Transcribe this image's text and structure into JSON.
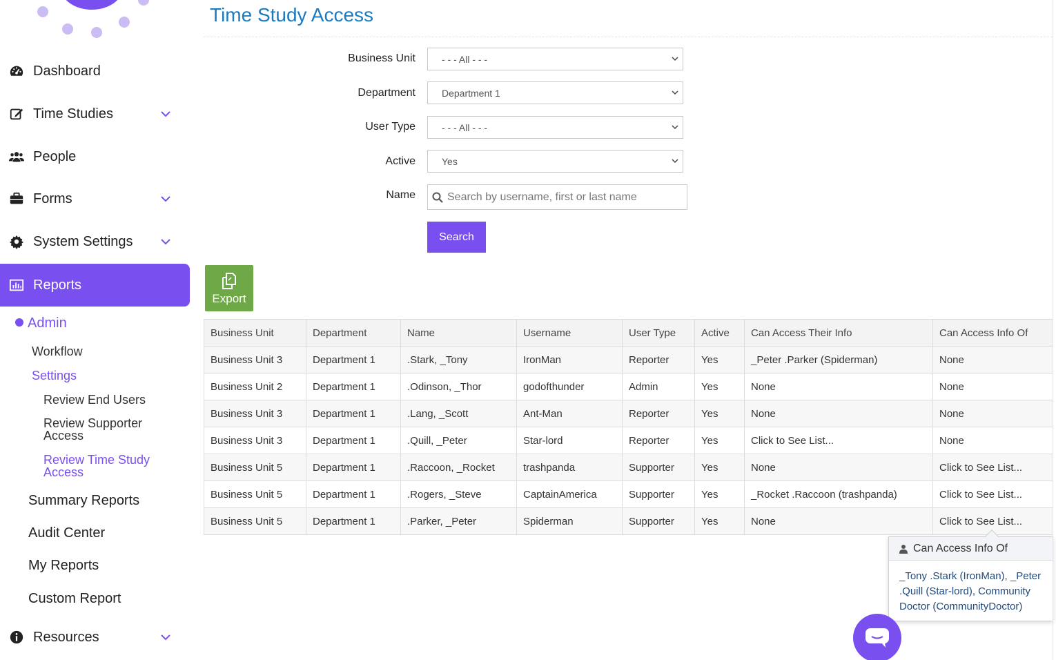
{
  "page_title": "Time Study Access",
  "sidebar": {
    "nav": [
      {
        "label": "Dashboard",
        "icon": "dashboard-icon",
        "has_chevron": false
      },
      {
        "label": "Time Studies",
        "icon": "edit-icon",
        "has_chevron": true
      },
      {
        "label": "People",
        "icon": "users-icon",
        "has_chevron": false
      },
      {
        "label": "Forms",
        "icon": "briefcase-icon",
        "has_chevron": true
      },
      {
        "label": "System Settings",
        "icon": "gear-icon",
        "has_chevron": true
      },
      {
        "label": "Reports",
        "icon": "bar-chart-icon",
        "has_chevron": false,
        "active": true
      }
    ],
    "reports_sub": {
      "admin": "Admin",
      "workflow": "Workflow",
      "settings": "Settings",
      "review_end_users": "Review End Users",
      "review_supporter_access_1": "Review Supporter",
      "review_supporter_access_2": "Access",
      "review_time_study_access_1": "Review Time Study",
      "review_time_study_access_2": "Access",
      "summary_reports": "Summary Reports",
      "audit_center": "Audit Center",
      "my_reports": "My Reports",
      "custom_report": "Custom Report"
    },
    "resources": {
      "label": "Resources",
      "icon": "info-icon"
    }
  },
  "filters": {
    "business_unit": {
      "label": "Business Unit",
      "value": "- - - All - - -"
    },
    "department": {
      "label": "Department",
      "value": "Department 1"
    },
    "user_type": {
      "label": "User Type",
      "value": "- - - All - - -"
    },
    "active": {
      "label": "Active",
      "value": "Yes"
    },
    "name": {
      "label": "Name",
      "placeholder": "Search by username, first or last name"
    },
    "search_button": "Search"
  },
  "export_label": "Export",
  "table": {
    "headers": [
      "Business Unit",
      "Department",
      "Name",
      "Username",
      "User Type",
      "Active",
      "Can Access Their Info",
      "Can Access Info Of"
    ],
    "rows": [
      [
        "Business Unit 3",
        "Department 1",
        ".Stark, _Tony",
        "IronMan",
        "Reporter",
        "Yes",
        "_Peter .Parker (Spiderman)",
        "None"
      ],
      [
        "Business Unit 2",
        "Department 1",
        ".Odinson, _Thor",
        "godofthunder",
        "Admin",
        "Yes",
        "None",
        "None"
      ],
      [
        "Business Unit 3",
        "Department 1",
        ".Lang, _Scott",
        "Ant-Man",
        "Reporter",
        "Yes",
        "None",
        "None"
      ],
      [
        "Business Unit 3",
        "Department 1",
        ".Quill, _Peter",
        "Star-lord",
        "Reporter",
        "Yes",
        "Click to See List...",
        "None"
      ],
      [
        "Business Unit 5",
        "Department 1",
        ".Raccoon, _Rocket",
        "trashpanda",
        "Supporter",
        "Yes",
        "None",
        "Click to See List..."
      ],
      [
        "Business Unit 5",
        "Department 1",
        ".Rogers, _Steve",
        "CaptainAmerica",
        "Supporter",
        "Yes",
        "_Rocket .Raccoon (trashpanda)",
        "Click to See List..."
      ],
      [
        "Business Unit 5",
        "Department 1",
        ".Parker, _Peter",
        "Spiderman",
        "Supporter",
        "Yes",
        "None",
        "Click to See List..."
      ]
    ]
  },
  "popover": {
    "title": "Can Access Info Of",
    "line1": "_Tony .Stark (IronMan), _Peter",
    "line2": ".Quill (Star-lord), Community",
    "line3": "Doctor (CommunityDoctor)"
  },
  "colors": {
    "accent": "#7a4ff0",
    "title_blue": "#1a7bc1",
    "export_green": "#6ea847"
  }
}
